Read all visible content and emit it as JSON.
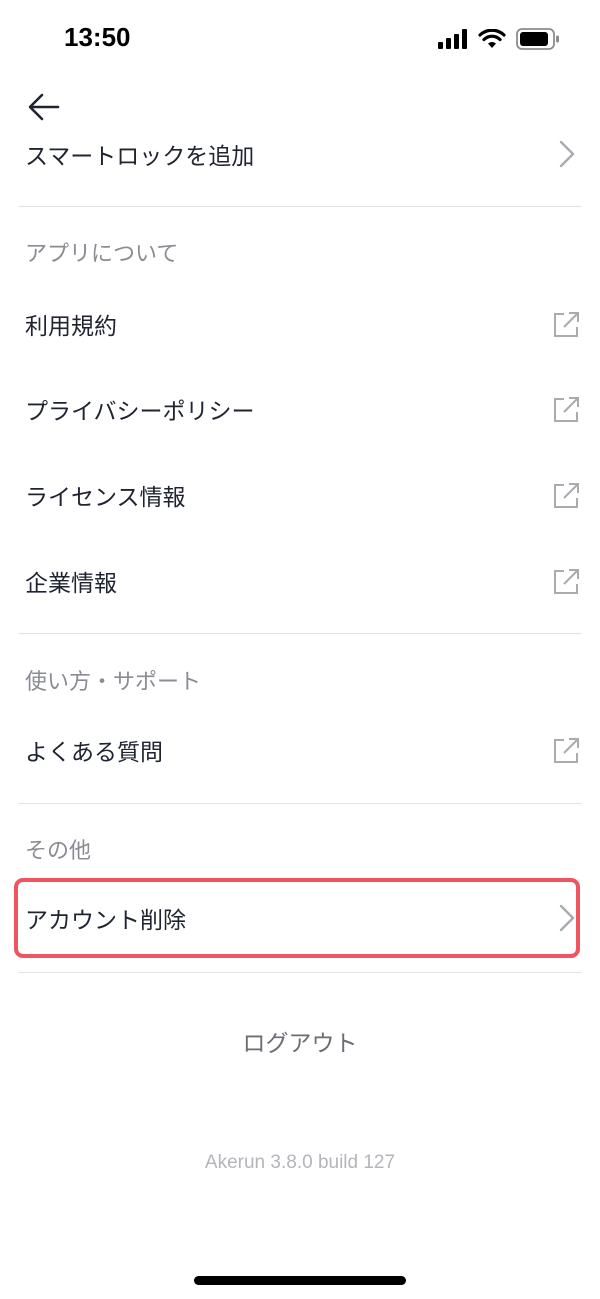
{
  "status_bar": {
    "time": "13:50"
  },
  "navigation": {
    "back_icon": "arrow-left-icon"
  },
  "top_item": {
    "label": "スマートロックを追加",
    "icon": "chevron-right-icon"
  },
  "sections": {
    "about": {
      "header": "アプリについて",
      "items": [
        {
          "label": "利用規約",
          "icon": "external-link-icon"
        },
        {
          "label": "プライバシーポリシー",
          "icon": "external-link-icon"
        },
        {
          "label": "ライセンス情報",
          "icon": "external-link-icon"
        },
        {
          "label": "企業情報",
          "icon": "external-link-icon"
        }
      ]
    },
    "support": {
      "header": "使い方・サポート",
      "items": [
        {
          "label": "よくある質問",
          "icon": "external-link-icon"
        }
      ]
    },
    "other": {
      "header": "その他",
      "items": [
        {
          "label": "アカウント削除",
          "icon": "chevron-right-icon",
          "highlighted": true
        }
      ]
    }
  },
  "logout_label": "ログアウト",
  "version_text": "Akerun 3.8.0 build 127",
  "colors": {
    "text_primary": "#1f2430",
    "text_secondary": "#8a8c93",
    "divider": "#e2e3e6",
    "highlight": "#ee5560",
    "icon_gray": "#a9abb0"
  }
}
